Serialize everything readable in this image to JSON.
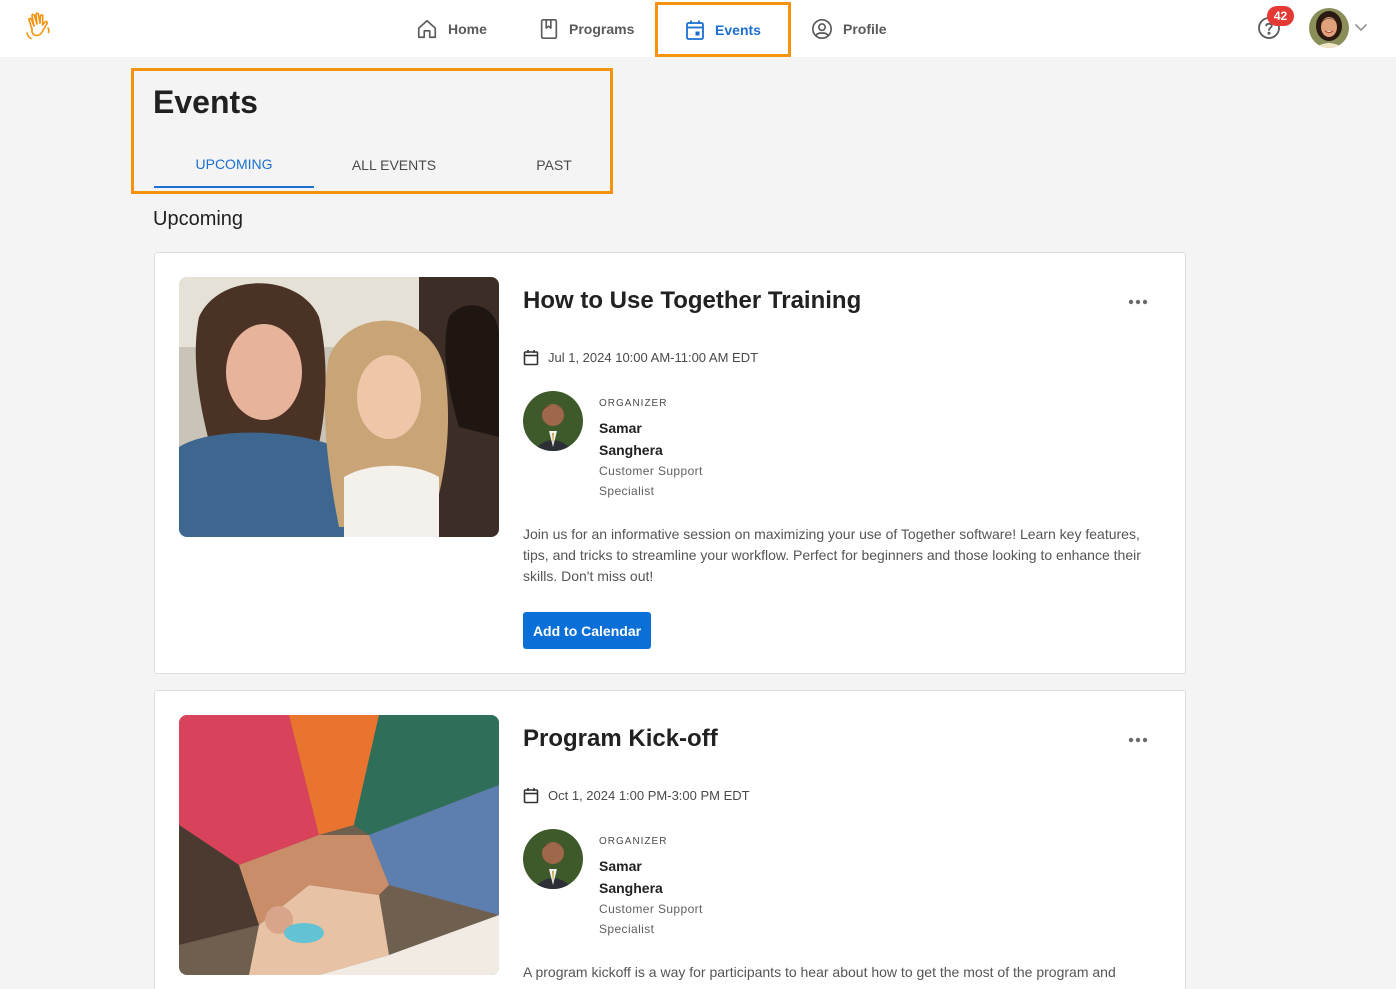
{
  "nav": {
    "items": [
      {
        "label": "Home",
        "icon": "home-icon"
      },
      {
        "label": "Programs",
        "icon": "book-icon"
      },
      {
        "label": "Events",
        "icon": "calendar-icon",
        "active": true
      },
      {
        "label": "Profile",
        "icon": "user-circle-icon"
      }
    ],
    "help_badge": "42",
    "accent_color": "#1a6fd1",
    "highlight_color": "#f5930e"
  },
  "page": {
    "title": "Events",
    "tabs": [
      {
        "label": "UPCOMING",
        "active": true
      },
      {
        "label": "ALL EVENTS",
        "active": false
      },
      {
        "label": "PAST",
        "active": false
      }
    ],
    "section_title": "Upcoming"
  },
  "events": [
    {
      "title": "How to Use Together Training",
      "date": "Jul 1, 2024 10:00 AM-11:00 AM EDT",
      "organizer_label": "ORGANIZER",
      "organizer_name": "Samar Sanghera",
      "organizer_role": "Customer Support Specialist",
      "description": "Join us for an informative session on maximizing your use of Together software! Learn key features, tips, and tricks to streamline your workflow. Perfect for beginners and those looking to enhance their skills. Don't miss out!",
      "button_label": "Add to Calendar"
    },
    {
      "title": "Program Kick-off",
      "date": "Oct 1, 2024 1:00 PM-3:00 PM EDT",
      "organizer_label": "ORGANIZER",
      "organizer_name": "Samar Sanghera",
      "organizer_role": "Customer Support Specialist",
      "description": "A program kickoff is a way for participants to hear about how to get the most of the program and"
    }
  ]
}
